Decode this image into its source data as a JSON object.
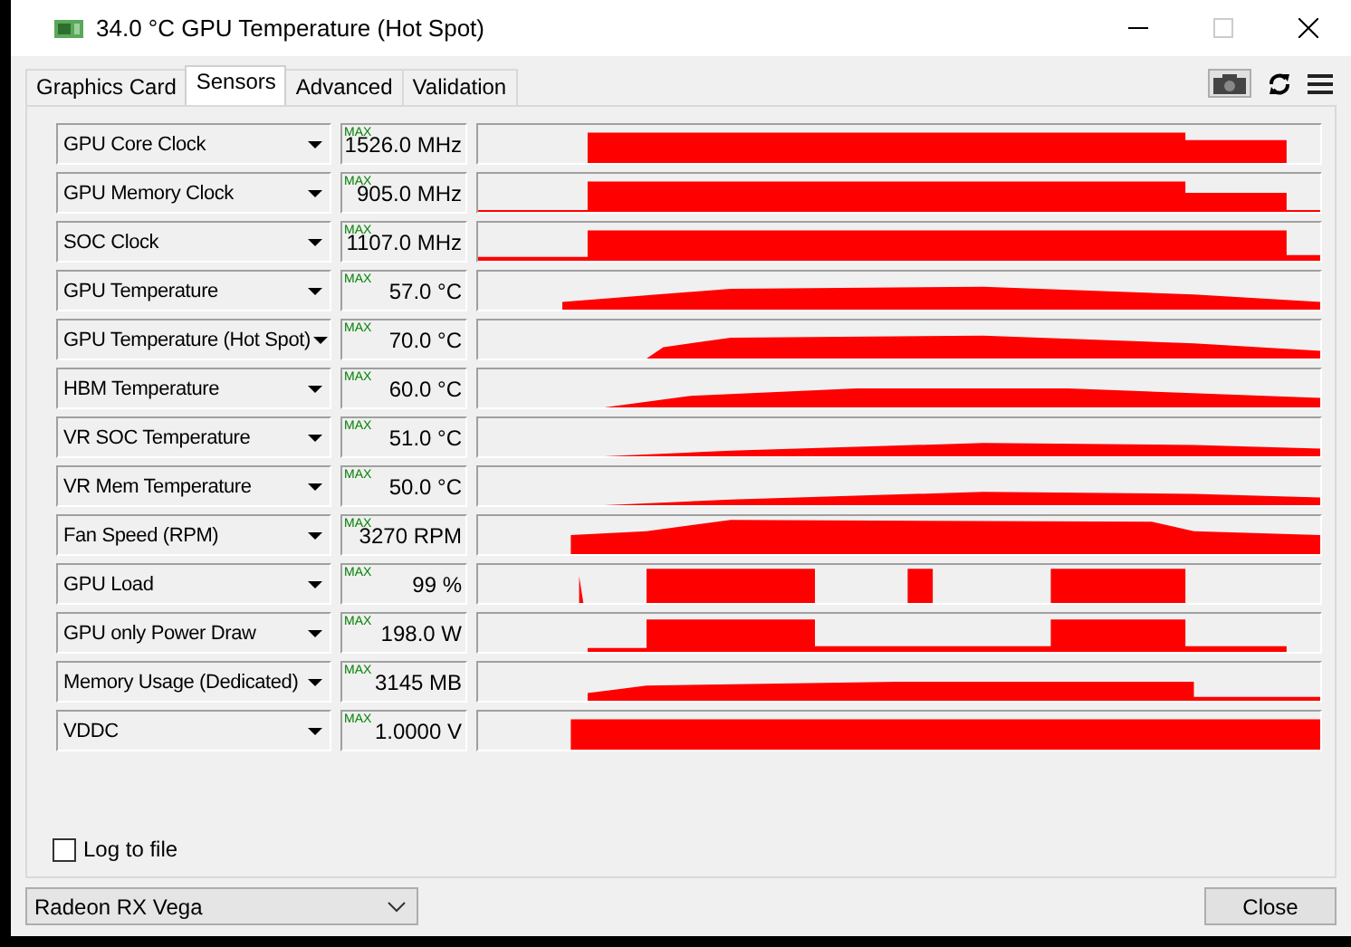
{
  "window": {
    "title": "34.0 °C GPU Temperature (Hot Spot)"
  },
  "tabs": [
    {
      "label": "Graphics Card",
      "selected": false
    },
    {
      "label": "Sensors",
      "selected": true
    },
    {
      "label": "Advanced",
      "selected": false
    },
    {
      "label": "Validation",
      "selected": false
    }
  ],
  "sensors": [
    {
      "name": "GPU Core Clock",
      "flag": "MAX",
      "value": "1526.0 MHz"
    },
    {
      "name": "GPU Memory Clock",
      "flag": "MAX",
      "value": "905.0 MHz"
    },
    {
      "name": "SOC Clock",
      "flag": "MAX",
      "value": "1107.0 MHz"
    },
    {
      "name": "GPU Temperature",
      "flag": "MAX",
      "value": "57.0 °C"
    },
    {
      "name": "GPU Temperature (Hot Spot)",
      "flag": "MAX",
      "value": "70.0 °C"
    },
    {
      "name": "HBM Temperature",
      "flag": "MAX",
      "value": "60.0 °C"
    },
    {
      "name": "VR SOC Temperature",
      "flag": "MAX",
      "value": "51.0 °C"
    },
    {
      "name": "VR Mem Temperature",
      "flag": "MAX",
      "value": "50.0 °C"
    },
    {
      "name": "Fan Speed (RPM)",
      "flag": "MAX",
      "value": "3270 RPM"
    },
    {
      "name": "GPU Load",
      "flag": "MAX",
      "value": "99 %"
    },
    {
      "name": "GPU only Power Draw",
      "flag": "MAX",
      "value": "198.0 W"
    },
    {
      "name": "Memory Usage (Dedicated)",
      "flag": "MAX",
      "value": "3145 MB"
    },
    {
      "name": "VDDC",
      "flag": "MAX",
      "value": "1.0000 V"
    }
  ],
  "log_to_file": {
    "label": "Log to file",
    "checked": false
  },
  "gpu_select": {
    "value": "Radeon RX Vega"
  },
  "buttons": [
    "Close"
  ]
}
